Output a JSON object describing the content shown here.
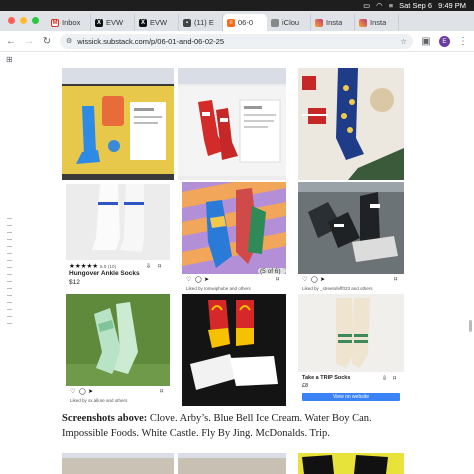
{
  "menubar": {
    "date": "Sat Sep 6",
    "time": "9:49 PM"
  },
  "tabs": [
    {
      "label": "Inbox",
      "icon": "gmail-icon",
      "color": "#d93025"
    },
    {
      "label": "EVW",
      "icon": "x-icon",
      "color": "#111111"
    },
    {
      "label": "EVW",
      "icon": "x-icon",
      "color": "#111111"
    },
    {
      "label": "(11) E",
      "icon": "app-icon",
      "color": "#444444"
    },
    {
      "label": "06-0",
      "icon": "substack-icon",
      "color": "#ff6719"
    },
    {
      "label": "iClou",
      "icon": "apple-icon",
      "color": "#777777"
    },
    {
      "label": "Insta",
      "icon": "instagram-icon",
      "color": "#c13584"
    },
    {
      "label": "Insta",
      "icon": "instagram-icon",
      "color": "#c13584"
    }
  ],
  "address": {
    "url": "wissick.substack.com/p/06-01-and-06-02-25",
    "profile_initial": "E"
  },
  "posts": {
    "hungover": {
      "name": "Hungover Ankle Socks",
      "price": "$12",
      "rating": "5.0",
      "count": "(10)"
    },
    "counter": "(5 of 6)",
    "liked_middle": "Liked by tomwiphube and others",
    "liked_right": "Liked by _streetofeff023 and others",
    "liked_bottom_left": "Liked by sx.allure and others",
    "trip": {
      "name": "Take a TRIP Socks",
      "price": "£8",
      "button": "View on website"
    }
  },
  "caption": {
    "label": "Screenshots above:",
    "text": " Clove. Arby’s. Blue Bell Ice Cream. Water Boy Can. Impossible Foods. White Castle. Fly By Jing. McDonalds. Trip."
  }
}
